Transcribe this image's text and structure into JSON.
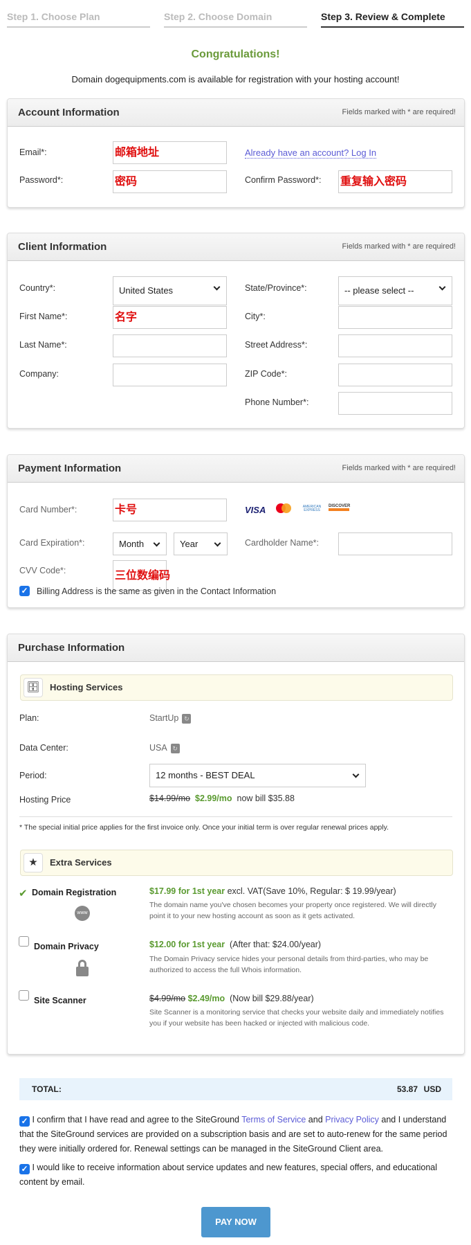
{
  "steps": [
    "Step 1. Choose Plan",
    "Step 2. Choose Domain",
    "Step 3. Review & Complete"
  ],
  "congrats": "Congratulations!",
  "availability": "Domain dogequipments.com is available for registration with your hosting account!",
  "required_note": "Fields marked with * are required!",
  "account": {
    "title": "Account Information",
    "email_label": "Email*:",
    "email_value": "邮箱地址",
    "login_link": "Already have an account? Log In",
    "password_label": "Password*:",
    "password_value": "密码",
    "confirm_label": "Confirm Password*:",
    "confirm_value": "重复输入密码"
  },
  "client": {
    "title": "Client Information",
    "country_label": "Country*:",
    "country_value": "United States",
    "state_label": "State/Province*:",
    "state_value": "-- please select --",
    "first_label": "First Name*:",
    "first_value": "名字",
    "city_label": "City*:",
    "last_label": "Last Name*:",
    "street_label": "Street Address*:",
    "company_label": "Company:",
    "zip_label": "ZIP Code*:",
    "phone_label": "Phone Number*:"
  },
  "payment": {
    "title": "Payment Information",
    "card_label": "Card Number*:",
    "card_value": "卡号",
    "cards": [
      "VISA",
      "MasterCard",
      "AMERICAN EXPRESS",
      "DISCOVER"
    ],
    "exp_label": "Card Expiration*:",
    "month": "Month",
    "year": "Year",
    "holder_label": "Cardholder Name*:",
    "cvv_label": "CVV Code*:",
    "cvv_value": "三位数编码",
    "billing_same": "Billing Address is the same as given in the Contact Information"
  },
  "purchase": {
    "title": "Purchase Information",
    "hosting_title": "Hosting Services",
    "plan_label": "Plan:",
    "plan_value": "StartUp",
    "dc_label": "Data Center:",
    "dc_value": "USA",
    "period_label": "Period:",
    "period_value": "12 months - BEST DEAL",
    "price_label": "Hosting Price",
    "price_old": "$14.99/mo",
    "price_new": "$2.99/mo",
    "price_bill": "now bill $35.88",
    "footnote": "* The special initial price applies for the first invoice only. Once your initial term is over regular renewal prices apply.",
    "extra_title": "Extra Services",
    "extras": [
      {
        "name": "Domain Registration",
        "price": "$17.99 for 1st year",
        "note": " excl. VAT(Save 10%, Regular: $ 19.99/year)",
        "desc": "The domain name you've chosen becomes your property once registered. We will directly point it to your new hosting account as soon as it gets activated.",
        "checked": true
      },
      {
        "name": "Domain Privacy",
        "price": "$12.00 for 1st year",
        "note": "  (After that: $24.00/year)",
        "desc": "The Domain Privacy service hides your personal details from third-parties, who may be authorized to access the full Whois information.",
        "checked": false
      },
      {
        "name": "Site Scanner",
        "old": "$4.99/mo",
        "price": "$2.49/mo",
        "note": "  (Now bill $29.88/year)",
        "desc": "Site Scanner is a monitoring service that checks your website daily and immediately notifies you if your website has been hacked or injected with malicious code.",
        "checked": false
      }
    ]
  },
  "total": {
    "label": "TOTAL:",
    "amount": "53.87",
    "currency": "USD"
  },
  "consent": {
    "a": "I confirm that I have read and agree to the SiteGround ",
    "tos": "Terms of Service",
    "and": " and ",
    "pp": "Privacy Policy",
    "b": " and I understand that the SiteGround services are provided on a subscription basis and are set to auto-renew for the same period they were initially ordered for. Renewal settings can be managed in the SiteGround Client area.",
    "newsletter": "I would like to receive information about service updates and new features, special offers, and educational content by email."
  },
  "pay_button": "PAY NOW"
}
